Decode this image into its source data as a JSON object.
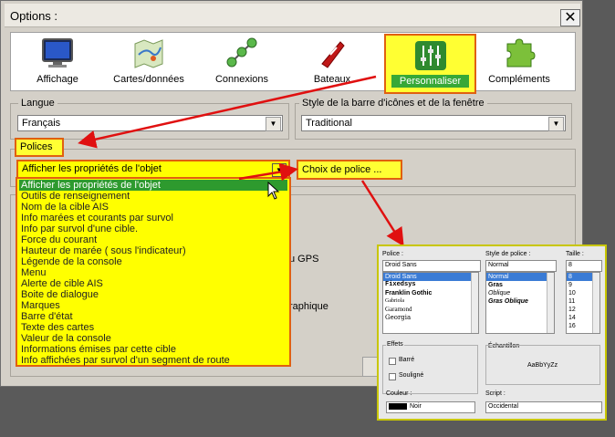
{
  "window": {
    "title": "Options :",
    "close_glyph": "✕"
  },
  "tabs": [
    {
      "label": "Affichage",
      "icon": "monitor-icon"
    },
    {
      "label": "Cartes/données",
      "icon": "map-icon"
    },
    {
      "label": "Connexions",
      "icon": "network-icon"
    },
    {
      "label": "Bateaux",
      "icon": "boat-icon"
    },
    {
      "label": "Personnaliser",
      "icon": "sliders-icon",
      "active": true
    },
    {
      "label": "Compléments",
      "icon": "puzzle-icon"
    }
  ],
  "langue": {
    "label": "Langue",
    "value": "Français"
  },
  "style": {
    "label": "Style de la barre d'icônes et de la fenêtre",
    "value": "Traditional"
  },
  "polices": {
    "label": "Polices",
    "selected": "Afficher les propriétés de l'objet",
    "choose_button": "Choix de police ...",
    "options": [
      "Afficher les propriétés de l'objet",
      "Outils de renseignement",
      "Nom de la cible AIS",
      "Info marées et courants par survol",
      "Info par survol d'une cible.",
      "Force du courant",
      "Hauteur de marée ( sous l'indicateur)",
      "Légende de la console",
      "Menu",
      "Alerte de cible AIS",
      "Boite de dialogue",
      "Marques",
      "Barre d'état",
      "Texte des cartes",
      "Valeur de la console",
      "Informations émises par cette cible",
      "Info affichées par survol d'un segment de route"
    ]
  },
  "background_fragments": {
    "gps": "u GPS",
    "graph": "raphique"
  },
  "font_dialog": {
    "police_label": "Police :",
    "police_value": "Droid Sans",
    "fonts": [
      "Droid Sans",
      "Fixedsys",
      "Franklin Gothic",
      "Gabriola",
      "Garamond",
      "Georgia"
    ],
    "style_label": "Style de police :",
    "style_value": "Normal",
    "styles": [
      "Normal",
      "Gras",
      "Oblique",
      "Gras Oblique"
    ],
    "size_label": "Taille :",
    "size_value": "8",
    "sizes": [
      "8",
      "9",
      "10",
      "11",
      "12",
      "14",
      "16"
    ],
    "effects_label": "Effets",
    "strike_label": "Barré",
    "underline_label": "Souligné",
    "color_label": "Couleur :",
    "color_value": "Noir",
    "sample_label": "Échantillon",
    "sample_text": "AaBbYyZz",
    "script_label": "Script :",
    "script_value": "Occidental"
  },
  "colors": {
    "highlight": "#ffff00",
    "border_accent": "#e06010",
    "selection_green": "#2e9a2e",
    "arrow_red": "#e01010"
  }
}
